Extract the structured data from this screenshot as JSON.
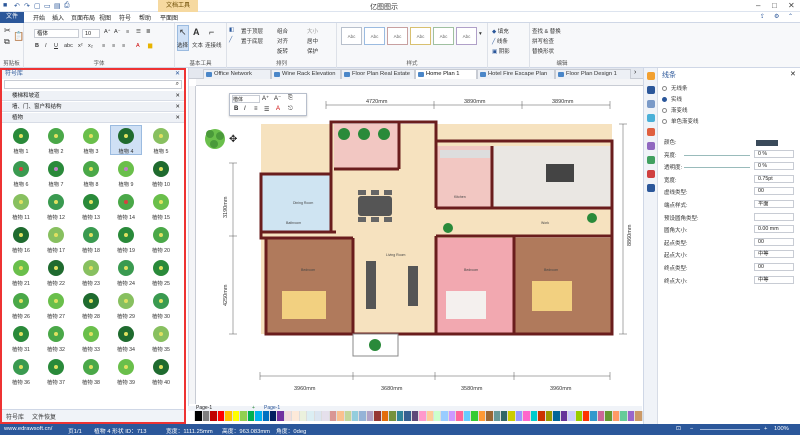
{
  "titlebar": {
    "app_title": "亿图图示",
    "doc_tools": "文档工具"
  },
  "menu": {
    "file": "文件",
    "items": [
      "开始",
      "插入",
      "页面布局",
      "视图",
      "符号",
      "帮助",
      "平面图"
    ]
  },
  "ribbon": {
    "clipboard_label": "剪贴板",
    "font_label": "字体",
    "basic_tools_label": "基本工具",
    "arrange_label": "排列",
    "style_label": "样式",
    "edit_label": "编辑",
    "font_name": "楷体",
    "font_size": "10",
    "select": "选择",
    "text": "文本",
    "connector": "连接线",
    "front": "置于顶层",
    "back": "置于底层",
    "group": "组合",
    "align": "对齐",
    "size": "大小",
    "center": "居中",
    "distribute": "分布",
    "rotate": "旋转",
    "protect": "保护",
    "fill": "填充",
    "line": "线条",
    "shadow": "阴影",
    "find_replace": "查找 & 替换",
    "spell": "拼写检查",
    "change_shape": "替换形状",
    "style_swatch": "Abc"
  },
  "library": {
    "title": "符号库",
    "search_placeholder": "",
    "categories": [
      "楼梯和坡道",
      "墙、门、窗户和结构",
      "植物"
    ],
    "plants": [
      "植物 1",
      "植物 2",
      "植物 3",
      "植物 4",
      "植物 5",
      "植物 6",
      "植物 7",
      "植物 8",
      "植物 9",
      "植物 10",
      "植物 11",
      "植物 12",
      "植物 13",
      "植物 14",
      "植物 15",
      "植物 16",
      "植物 17",
      "植物 18",
      "植物 19",
      "植物 20",
      "植物 21",
      "植物 22",
      "植物 23",
      "植物 24",
      "植物 25",
      "植物 26",
      "植物 27",
      "植物 28",
      "植物 29",
      "植物 30",
      "植物 31",
      "植物 32",
      "植物 33",
      "植物 34",
      "植物 35",
      "植物 36",
      "植物 37",
      "植物 38",
      "植物 39",
      "植物 40"
    ],
    "footer_tabs": [
      "符号库",
      "文件恢复"
    ]
  },
  "tabs": [
    "Office Network",
    "Wine Rack Elevation",
    "Floor Plan Real Estate",
    "Home Plan 1",
    "Hotel Fire Escape Plan",
    "Floor Plan Design 1"
  ],
  "plan": {
    "dims_top": [
      "4720mm",
      "3890mm",
      "3890mm"
    ],
    "dims_bottom": [
      "3960mm",
      "3680mm",
      "3580mm",
      "3960mm"
    ],
    "dims_left": [
      "3190mm",
      "4250mm"
    ],
    "dim_right": "8860mm",
    "rooms": [
      "Kitchen",
      "Dining Room",
      "Living Room",
      "Bathroom",
      "Work",
      "Bedroom",
      "Bedroom",
      "Bedroom"
    ]
  },
  "pagebar": {
    "page_name": "Page-1",
    "page_tab": "Page-1"
  },
  "rightpanel": {
    "title": "线条",
    "radios": [
      "无线条",
      "实线",
      "渐变线",
      "单色渐变线"
    ],
    "rows": [
      {
        "label": "颜色:",
        "value": ""
      },
      {
        "label": "亮度:",
        "value": "0 %"
      },
      {
        "label": "透明度:",
        "value": "0 %"
      },
      {
        "label": "宽度:",
        "value": "0.75pt"
      },
      {
        "label": "虚线类型:",
        "value": "00"
      },
      {
        "label": "端点样式:",
        "value": "平面"
      },
      {
        "label": "预设圆角类型:",
        "value": ""
      },
      {
        "label": "圆角大小:",
        "value": "0.00 mm"
      },
      {
        "label": "起点类型:",
        "value": "00"
      },
      {
        "label": "起点大小:",
        "value": "中等"
      },
      {
        "label": "终点类型:",
        "value": "00"
      },
      {
        "label": "终点大小:",
        "value": "中等"
      }
    ]
  },
  "status": {
    "url": "www.edrawsoft.cn/",
    "page": "页1/1",
    "shape": "植物 4  形状 ID：713",
    "width": "宽度：1111.25mm",
    "height": "高度：963.083mm",
    "angle": "角度：0deg",
    "zoom": "100%"
  },
  "colors": {
    "accent": "#2b579a",
    "highlight_border": "#e33"
  }
}
